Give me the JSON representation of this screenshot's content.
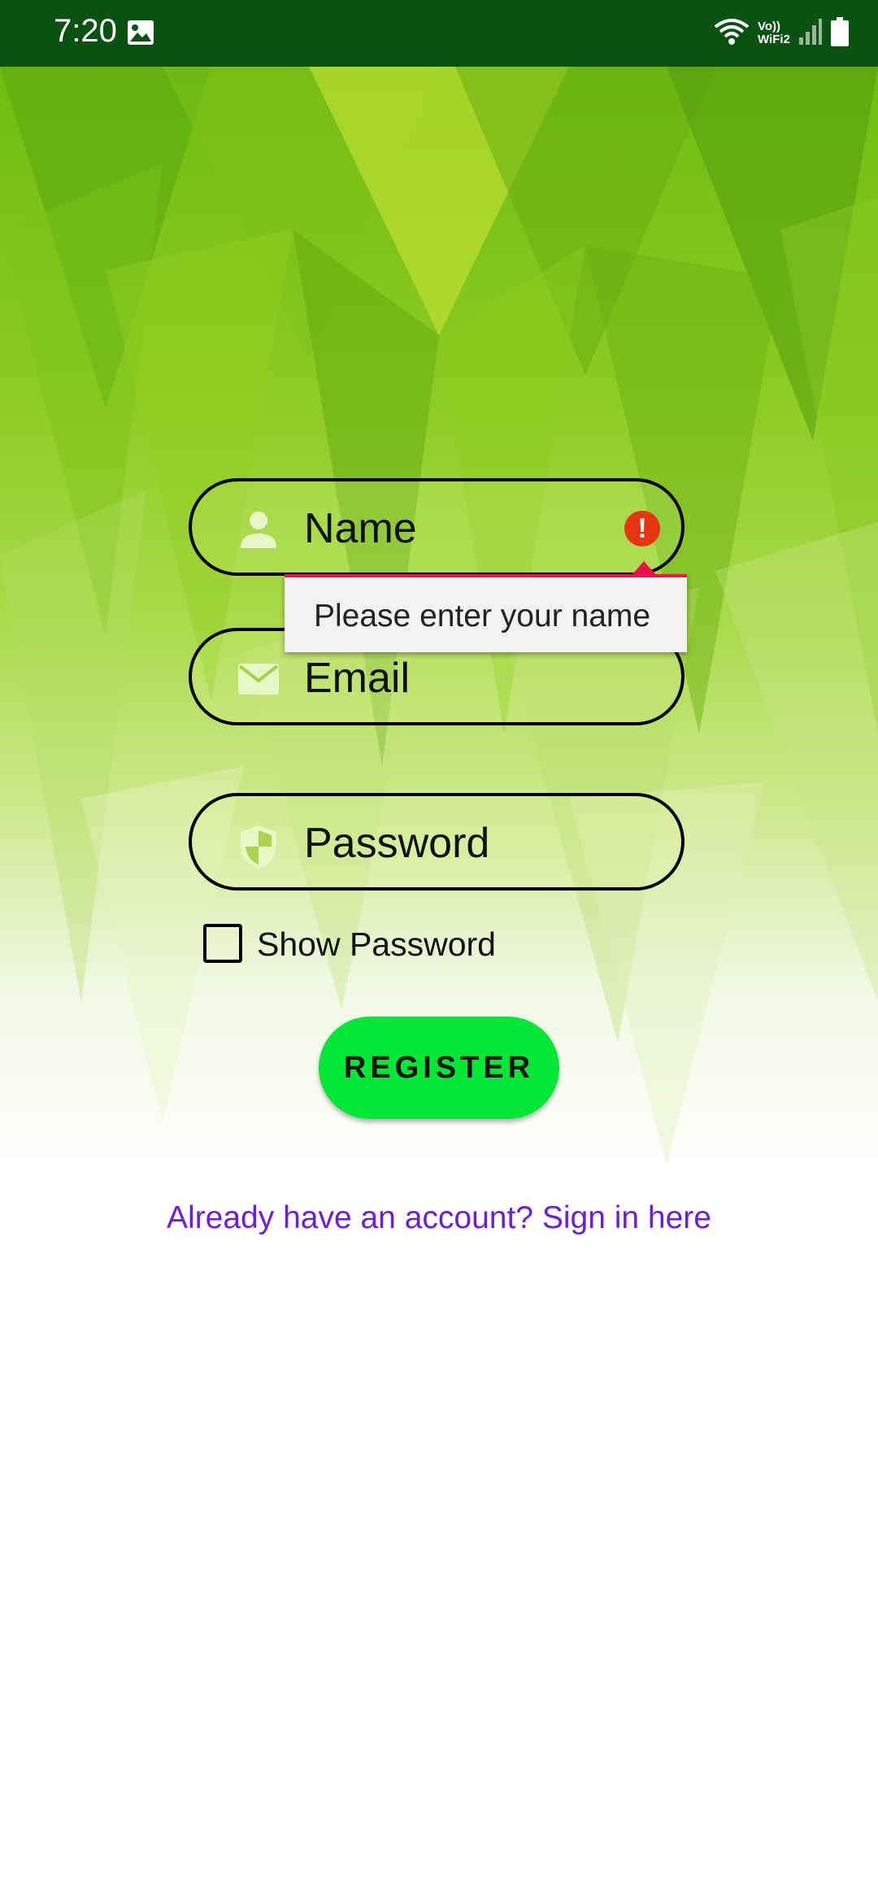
{
  "status_bar": {
    "time": "7:20",
    "network_label": "Vo)) WiFi2",
    "icons": [
      "gallery-icon",
      "wifi-icon",
      "signal-icon",
      "battery-icon"
    ]
  },
  "form": {
    "name": {
      "placeholder": "Name",
      "icon": "person-icon",
      "error_icon": "alert-icon",
      "error_message": "Please enter your name"
    },
    "email": {
      "placeholder": "Email",
      "icon": "mail-icon"
    },
    "password": {
      "placeholder": "Password",
      "icon": "shield-icon"
    },
    "show_password": {
      "label": "Show Password",
      "checked": false
    },
    "register_label": "REGISTER",
    "signin_link": "Already have an account? Sign in here"
  },
  "colors": {
    "status_bar": "#0a5212",
    "error": "#e53512",
    "tooltip_accent": "#e8144a",
    "register_button": "#00e736",
    "link": "#6c1fd6"
  }
}
